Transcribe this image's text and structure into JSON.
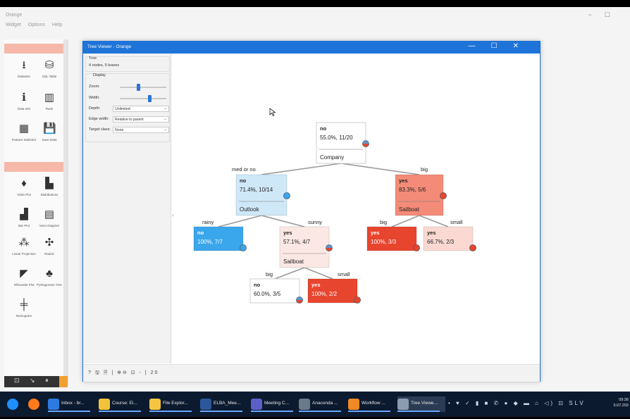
{
  "app": {
    "title": "Orange",
    "menu": [
      "Widget",
      "Options",
      "Help"
    ],
    "window_controls": [
      "−",
      "☐"
    ]
  },
  "widget_panel": {
    "widgets": [
      {
        "label": "Datasets",
        "icon": "datasets-icon",
        "glyph": "⭳"
      },
      {
        "label": "SQL Table",
        "icon": "database-icon",
        "glyph": "⛁"
      },
      {
        "label": "Data Info",
        "icon": "info-icon",
        "glyph": "ℹ"
      },
      {
        "label": "Rank",
        "icon": "rank-icon",
        "glyph": "▥"
      },
      {
        "label": "Feature Statistics",
        "icon": "feature-statistics-icon",
        "glyph": "▦"
      },
      {
        "label": "Save Data",
        "icon": "save-icon",
        "glyph": "💾"
      },
      {
        "label": "Violin Plot",
        "icon": "violin-icon",
        "glyph": "♦"
      },
      {
        "label": "Distributions",
        "icon": "distributions-icon",
        "glyph": "▙"
      },
      {
        "label": "Bar Plot",
        "icon": "bar-plot-icon",
        "glyph": "▟"
      },
      {
        "label": "Venn Diagram",
        "icon": "venn-icon",
        "glyph": "▤"
      },
      {
        "label": "Linear Projection",
        "icon": "projection-icon",
        "glyph": "⁂"
      },
      {
        "label": "Radviz",
        "icon": "radviz-icon",
        "glyph": "✣"
      },
      {
        "label": "Silhouette Plot",
        "icon": "silhouette-icon",
        "glyph": "◤"
      },
      {
        "label": "Pythagorean Tree",
        "icon": "pythagorean-tree-icon",
        "glyph": "♣"
      },
      {
        "label": "Nomogram",
        "icon": "nomogram-icon",
        "glyph": "╪"
      }
    ],
    "footer_icons": "⊡ ↘ ⏸"
  },
  "tree_viewer": {
    "title": "Tree Viewer - Orange",
    "controls": [
      "—",
      "☐",
      "✕"
    ],
    "tree_section": "Tree",
    "tree_info": "4 nodes, 5 leaves",
    "display_section": "Display",
    "zoom_label": "Zoom:",
    "zoom_level": 0.4,
    "width_label": "Width:",
    "width_level": 0.65,
    "depth_label": "Depth:",
    "depth_value": "Unlimited",
    "edge_width_label": "Edge width:",
    "edge_width_value": "Relative to parent",
    "target_class_label": "Target class:",
    "target_class_value": "None",
    "status_icons": "? 🖫 🗎 | ⊕⊖ ⊡ - | 20",
    "collapse_glyph": "›"
  },
  "tree": {
    "colors": {
      "blue_strong": "#3aa6ec",
      "blue_light": "#cfe8f8",
      "red_strong": "#e8452f",
      "red_mid": "#f38b78",
      "red_light": "#fbd9d2",
      "white": "#ffffff"
    },
    "nodes": [
      {
        "id": "root",
        "cls": "no",
        "stat": "55.0%, 11/20",
        "split": "Company",
        "fill": "#ffffff",
        "bold": false
      },
      {
        "id": "medno",
        "cls": "no",
        "stat": "71.4%, 10/14",
        "split": "Outlook",
        "fill": "#cfe8f8",
        "bold": true
      },
      {
        "id": "big",
        "cls": "yes",
        "stat": "83.3%, 5/6",
        "split": "Sailboat",
        "fill": "#f38b78",
        "bold": true
      },
      {
        "id": "rainy",
        "cls": "no",
        "stat": "100%, 7/7",
        "split": "",
        "fill": "#3aa6ec",
        "bold": true
      },
      {
        "id": "sunny",
        "cls": "yes",
        "stat": "57.1%, 4/7",
        "split": "Sailboat",
        "fill": "#fbe8e4",
        "bold": true
      },
      {
        "id": "big_big",
        "cls": "yes",
        "stat": "100%, 3/3",
        "split": "",
        "fill": "#e8452f",
        "bold": true
      },
      {
        "id": "big_small",
        "cls": "yes",
        "stat": "66.7%, 2/3",
        "split": "",
        "fill": "#fbd9d2",
        "bold": true
      },
      {
        "id": "sunny_big",
        "cls": "no",
        "stat": "60.0%, 3/5",
        "split": "",
        "fill": "#ffffff",
        "bold": true
      },
      {
        "id": "sunny_small",
        "cls": "yes",
        "stat": "100%, 2/2",
        "split": "",
        "fill": "#e8452f",
        "bold": true
      }
    ],
    "edges": [
      {
        "from": "root",
        "to": "medno",
        "label": "med or no"
      },
      {
        "from": "root",
        "to": "big",
        "label": "big"
      },
      {
        "from": "medno",
        "to": "rainy",
        "label": "rainy"
      },
      {
        "from": "medno",
        "to": "sunny",
        "label": "sunny"
      },
      {
        "from": "big",
        "to": "big_big",
        "label": "big"
      },
      {
        "from": "big",
        "to": "big_small",
        "label": "small"
      },
      {
        "from": "sunny",
        "to": "sunny_big",
        "label": "big"
      },
      {
        "from": "sunny",
        "to": "sunny_small",
        "label": "small"
      }
    ]
  },
  "taskbar": {
    "items": [
      {
        "label": "",
        "icon": "windows-start-icon",
        "color": "#1f8fff"
      },
      {
        "label": "",
        "icon": "firefox-icon",
        "color": "#ff7a1a"
      },
      {
        "label": "Inbox - br...",
        "icon": "mail-icon",
        "color": "#2d7be0"
      },
      {
        "label": "Course: Ei...",
        "icon": "chrome-icon",
        "color": "#f2c23a"
      },
      {
        "label": "File Explor...",
        "icon": "folder-icon",
        "color": "#f5c542"
      },
      {
        "label": "ELBA_Mee...",
        "icon": "word-icon",
        "color": "#2b579a"
      },
      {
        "label": "Meeting C...",
        "icon": "teams-icon",
        "color": "#5b5fc7"
      },
      {
        "label": "Anaconda ...",
        "icon": "anaconda-icon",
        "color": "#6a7a8a"
      },
      {
        "label": "Workflow ...",
        "icon": "orange-icon",
        "color": "#f08a24"
      },
      {
        "label": "Tree Viewe...",
        "icon": "orange-window-icon",
        "color": "#8b9bb0"
      }
    ],
    "tray": "• ♥ ✓ ▮ ■ ✆ ● ◆ ▬ ⌂ ◁) ⊡ SLV",
    "time": "09:36",
    "date": "5.07.202"
  }
}
